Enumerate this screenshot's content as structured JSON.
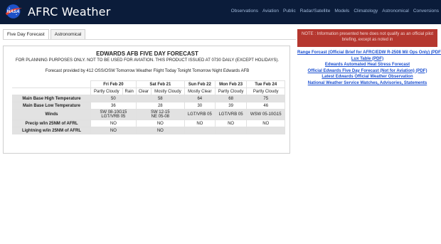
{
  "header": {
    "title": "AFRC Weather",
    "logo_icon": "nasa-meatball-logo",
    "nav": [
      "Observations",
      "Aviation",
      "Public",
      "Radar/Satellite",
      "Models",
      "Climatology",
      "Astronomical",
      "Conversions"
    ]
  },
  "tabs": [
    {
      "label": "Five Day Forecast",
      "active": true
    },
    {
      "label": "Astronomical",
      "active": false
    }
  ],
  "forecast": {
    "title": "EDWARDS AFB FIVE DAY FORECAST",
    "subtitle": "FOR PLANNING PURPOSES ONLY. NOT TO BE USED FOR AVIATION. THIS PRODUCT ISSUED AT 0730 DAILY (EXCEPT HOLIDAYS).",
    "provided_by": "Forecast provided by 412 OSS/OSW Tomorrow Weather Flight Today Tonight Tomorrow Night Edwards AFB",
    "days": [
      "Fri Feb 20",
      "Sat Feb 21",
      "Sun Feb 22",
      "Mon Feb 23",
      "Tue Feb 24"
    ],
    "conditions": [
      "Partly Cloudy",
      "Rain",
      "Clear",
      "Mostly Cloudy",
      "Mostly Clear",
      "Partly Cloudy",
      "Partly Cloudy"
    ],
    "rows": {
      "high_label": "Main Base High Temperature",
      "high": [
        "50",
        "58",
        "64",
        "68",
        "75"
      ],
      "low_label": "Main Base Low Temperature",
      "low": [
        "36",
        "28",
        "30",
        "39",
        "46"
      ],
      "winds_label": "Winds",
      "winds_fri": [
        "SW 08-10G15",
        "LGT/VRB 05"
      ],
      "winds_sat": [
        "SW 12-15",
        "NE 05-08"
      ],
      "winds": [
        "LGT/VRB 05",
        "LGT/VRB 05",
        "WSW 05-10G15"
      ],
      "precip_label": "Precip w/in 25NM of AFRL",
      "precip": [
        "NO",
        "NO",
        "NO",
        "NO",
        "NO"
      ],
      "lightning_label": "Lightning w/in 25NM of AFRL",
      "lightning": [
        "NO",
        "NO"
      ]
    }
  },
  "notice": "NOTE : Information presented here does not qualify as an official pilot briefing, except as noted in",
  "links": [
    "Range Forcast (Official Brief for AFRC/EDW R-2508 Mil Ops Only) (PDF)",
    "Lux Table (PDF)",
    "Edwards Automated Heat Stress Forecast",
    "Official Edwards Five Day Forecast (Not for Aviation) (PDF)",
    "Latest Edwards Official Weather Observation",
    "National Weather Service Watches, Advisories, Statements"
  ],
  "colors": {
    "navbar": "#0b1c3a",
    "notice": "#b5372f",
    "link": "#1a4fd1"
  }
}
